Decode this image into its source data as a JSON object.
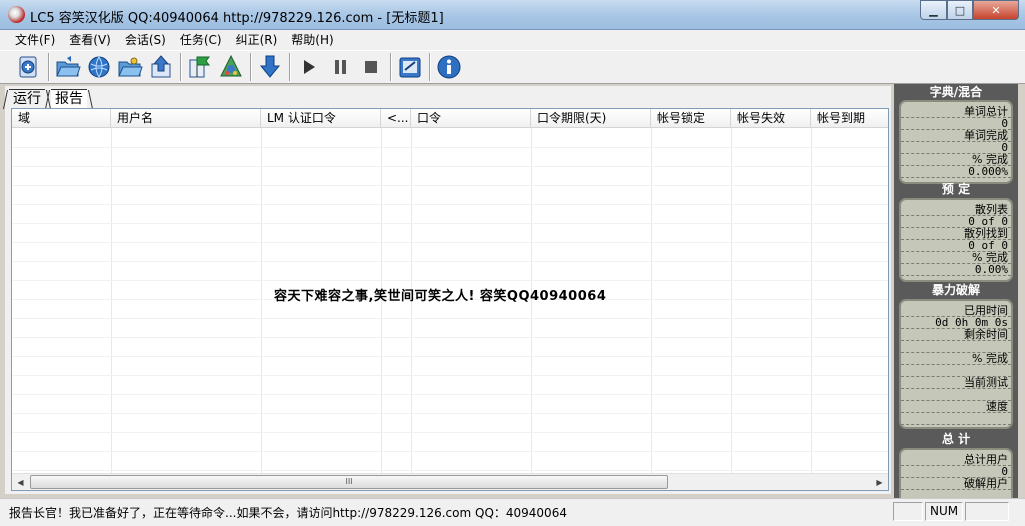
{
  "window": {
    "title": "LC5 容笑汉化版 QQ:40940064 http://978229.126.com - [无标题1]",
    "min_glyph": "▁",
    "max_glyph": "□",
    "close_glyph": "✕"
  },
  "menu": [
    "文件(F)",
    "查看(V)",
    "会话(S)",
    "任务(C)",
    "纠正(R)",
    "帮助(H)"
  ],
  "toolbar": {
    "icons": [
      "new-session-icon",
      "open-folder-icon",
      "import-globe-icon",
      "open-folder-2-icon",
      "import-up-icon",
      "wizard-flag-icon",
      "dictionary-icon",
      "download-arrow-icon",
      "play-icon",
      "pause-icon",
      "stop-icon",
      "settings-icon",
      "info-icon"
    ]
  },
  "tabs": [
    {
      "label": "运行",
      "active": false
    },
    {
      "label": "报告",
      "active": true
    }
  ],
  "grid": {
    "columns": [
      "域",
      "用户名",
      "LM 认证口令",
      "<...",
      "口令",
      "口令期限(天)",
      "帐号锁定",
      "帐号失效",
      "帐号到期"
    ],
    "banner": "容天下难容之事,笑世间可笑之人!     容笑QQ40940064",
    "scroll_grip": "III"
  },
  "side": {
    "dictionary": {
      "title": "字典/混合",
      "rows": [
        {
          "label": "单词总计",
          "value": "0"
        },
        {
          "label": "单词完成",
          "value": "0"
        },
        {
          "label": "% 完成",
          "value": "0.000%"
        }
      ]
    },
    "precalc": {
      "title": "预 定",
      "rows": [
        {
          "label": "散列表",
          "value": "0 of 0"
        },
        {
          "label": "散列找到",
          "value": "0 of 0"
        },
        {
          "label": "% 完成",
          "value": "0.00%"
        }
      ]
    },
    "brute": {
      "title": "暴力破解",
      "rows": [
        {
          "label": "已用时间",
          "value": "0d 0h 0m 0s"
        },
        {
          "label": "剩余时间",
          "value": ""
        },
        {
          "label": "% 完成",
          "value": ""
        },
        {
          "label": "当前测试",
          "value": ""
        },
        {
          "label": "速度",
          "value": ""
        }
      ]
    },
    "summary": {
      "title": "总 计",
      "rows": [
        {
          "label": "总计用户",
          "value": "0"
        },
        {
          "label": "破解用户",
          "value": ""
        }
      ]
    }
  },
  "status": {
    "message": "报告长官！我已准备好了，正在等待命令...如果不会，请访问http://978229.126.com QQ：40940064",
    "num": "NUM"
  },
  "colors": {
    "lcd_bg": "#c5c7b8",
    "panel_bg": "#5a5a5a",
    "close_red": "#c6442e"
  }
}
